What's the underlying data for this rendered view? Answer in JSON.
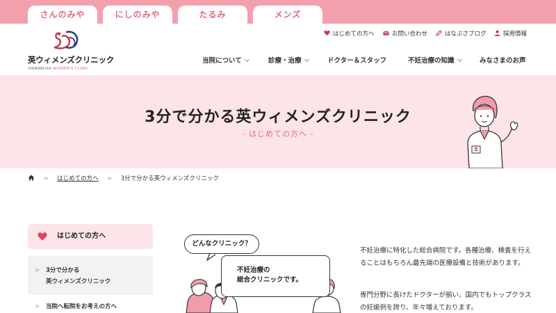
{
  "tabs": [
    {
      "label": "さんのみや"
    },
    {
      "label": "にしのみや"
    },
    {
      "label": "たるみ"
    },
    {
      "label": "メンズ"
    }
  ],
  "logo": {
    "name": "英ウィメンズクリニック",
    "sub_left": "HANABUSA",
    "sub_right": "WOMEN'S CLINIC"
  },
  "utility": [
    {
      "label": "はじめての方へ",
      "icon": "heart-icon"
    },
    {
      "label": "お問い合わせ",
      "icon": "mail-icon"
    },
    {
      "label": "はなぶさブログ",
      "icon": "pencil-icon"
    },
    {
      "label": "採用情報",
      "icon": "person-icon"
    }
  ],
  "nav": [
    {
      "label": "当院について",
      "has_dropdown": true
    },
    {
      "label": "診療・治療",
      "has_dropdown": true
    },
    {
      "label": "ドクター＆スタッフ",
      "has_dropdown": false
    },
    {
      "label": "不妊治療の知識",
      "has_dropdown": true
    },
    {
      "label": "みなさまのお声",
      "has_dropdown": false
    }
  ],
  "hero": {
    "title": "3分で分かる英ウィメンズクリニック",
    "subtitle": "- はじめての方へ -"
  },
  "breadcrumb": {
    "home_icon": "home-icon",
    "parent": "はじめての方へ",
    "current": "3分で分かる英ウィメンズクリニック"
  },
  "sidebar": {
    "heading": "はじめての方へ",
    "items": [
      {
        "line1": "3分で分かる",
        "line2": "英ウィメンズクリニック",
        "active": true
      },
      {
        "line1": "当院へ転院をお考えの方へ",
        "active": false
      }
    ]
  },
  "illustration": {
    "bubble_question": "どんなクリニック？",
    "bubble_answer_1": "不妊治療の",
    "bubble_answer_2": "総合クリニックです。"
  },
  "content": {
    "p1": "不妊治療に特化した総合病院です。各種治療、検査を行えることはもちろん最先端の医療設備と技術があります。",
    "p2": "専門分野に長けたドクターが揃い、国内でもトップクラスの妊娠例を誇り、年々増えております。"
  },
  "colors": {
    "accent": "#e46a80",
    "tab_bar": "#f3a0ad",
    "hero_bg": "#fce4e8"
  }
}
